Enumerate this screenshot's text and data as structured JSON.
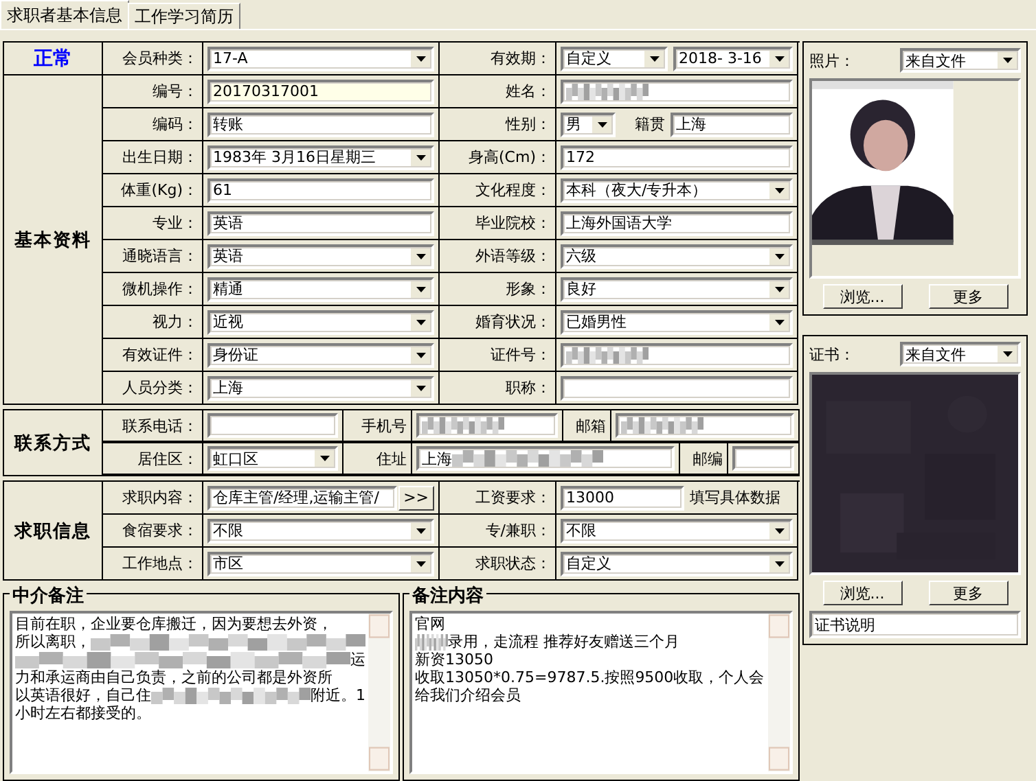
{
  "tabs": [
    {
      "label": "求职者基本信息",
      "selected": true
    },
    {
      "label": "工作学习简历",
      "selected": false
    }
  ],
  "header": {
    "status": "正常",
    "left": {
      "label": "会员种类：",
      "field": {
        "kind": "select",
        "value": "17-A"
      }
    },
    "right": {
      "label": "有效期：",
      "field": {
        "kind": "validity",
        "value": "自定义",
        "date": "2018- 3-16"
      }
    }
  },
  "basic": {
    "title": "基本资料",
    "rows": [
      {
        "left": {
          "label": "编号：",
          "field": {
            "kind": "highlighted",
            "value": "20170317001"
          }
        },
        "right": {
          "label": "姓名：",
          "field": {
            "kind": "redacted"
          }
        }
      },
      {
        "left": {
          "label": "编码：",
          "field": {
            "kind": "input",
            "value": "转账"
          }
        },
        "right": {
          "label": "性别：",
          "field": {
            "kind": "gender",
            "value": "男",
            "extra_label": "籍贯",
            "extra_value": "上海"
          }
        }
      },
      {
        "left": {
          "label": "出生日期：",
          "field": {
            "kind": "select",
            "value": "1983年 3月16日星期三"
          }
        },
        "right": {
          "label": "身高(Cm)：",
          "field": {
            "kind": "input",
            "value": "172"
          }
        }
      },
      {
        "left": {
          "label": "体重(Kg)：",
          "field": {
            "kind": "input",
            "value": "61"
          }
        },
        "right": {
          "label": "文化程度：",
          "field": {
            "kind": "select",
            "value": "本科（夜大/专升本）"
          }
        }
      },
      {
        "left": {
          "label": "专业：",
          "field": {
            "kind": "input",
            "value": "英语"
          }
        },
        "right": {
          "label": "毕业院校：",
          "field": {
            "kind": "input",
            "value": "上海外国语大学"
          }
        }
      },
      {
        "left": {
          "label": "通晓语言：",
          "field": {
            "kind": "select",
            "value": "英语"
          }
        },
        "right": {
          "label": "外语等级：",
          "field": {
            "kind": "select",
            "value": "六级"
          }
        }
      },
      {
        "left": {
          "label": "微机操作：",
          "field": {
            "kind": "select",
            "value": "精通"
          }
        },
        "right": {
          "label": "形象：",
          "field": {
            "kind": "select",
            "value": "良好"
          }
        }
      },
      {
        "left": {
          "label": "视力：",
          "field": {
            "kind": "select",
            "value": "近视"
          }
        },
        "right": {
          "label": "婚育状况：",
          "field": {
            "kind": "select",
            "value": "已婚男性"
          }
        }
      },
      {
        "left": {
          "label": "有效证件：",
          "field": {
            "kind": "select",
            "value": "身份证"
          }
        },
        "right": {
          "label": "证件号：",
          "field": {
            "kind": "redacted"
          }
        }
      },
      {
        "left": {
          "label": "人员分类：",
          "field": {
            "kind": "select",
            "value": "上海"
          }
        },
        "right": {
          "label": "职称：",
          "field": {
            "kind": "input"
          }
        }
      }
    ]
  },
  "contact": {
    "title": "联系方式",
    "rows": [
      [
        {
          "label": "联系电话：",
          "field": {
            "kind": "input"
          }
        },
        {
          "label": "手机号",
          "field": {
            "kind": "redacted"
          }
        },
        {
          "label": "邮箱",
          "field": {
            "kind": "redacted"
          }
        }
      ],
      [
        {
          "label": "居住区：",
          "field": {
            "kind": "select",
            "value": "虹口区"
          }
        },
        {
          "label": "住址",
          "field": {
            "kind": "partly-redacted",
            "value": "上海"
          }
        },
        {
          "label": "邮编",
          "field": {
            "kind": "input"
          }
        }
      ]
    ]
  },
  "job": {
    "title": "求职信息",
    "rows": [
      {
        "left": {
          "label": "求职内容：",
          "field": {
            "kind": "more",
            "value": "仓库主管/经理,运输主管/",
            "button": ">>"
          }
        },
        "right": {
          "label": "工资要求：",
          "field": {
            "kind": "note-input",
            "value": "13000",
            "note": "填写具体数据"
          }
        }
      },
      {
        "left": {
          "label": "食宿要求：",
          "field": {
            "kind": "select",
            "value": "不限"
          }
        },
        "right": {
          "label": "专/兼职：",
          "field": {
            "kind": "select",
            "value": "不限"
          }
        }
      },
      {
        "left": {
          "label": "工作地点：",
          "field": {
            "kind": "select",
            "value": "市区"
          }
        },
        "right": {
          "label": "求职状态：",
          "field": {
            "kind": "select",
            "value": "自定义"
          }
        }
      }
    ]
  },
  "notes": [
    {
      "title": "中介备注",
      "lines": [
        [
          {
            "kind": "text",
            "text": "目前在职，企业要仓库搬迁，因为要想去外资，"
          }
        ],
        [
          {
            "kind": "text",
            "text": "所以离职，"
          },
          {
            "kind": "redacted"
          }
        ],
        [
          {
            "kind": "redacted"
          },
          {
            "kind": "text",
            "text": "运"
          }
        ],
        [
          {
            "kind": "text",
            "text": "力和承运商由自己负责，之前的公司都是外资所"
          }
        ],
        [
          {
            "kind": "text",
            "text": "以英语很好，自己住"
          },
          {
            "kind": "redacted"
          },
          {
            "kind": "text",
            "text": "附近。1"
          }
        ],
        [
          {
            "kind": "text",
            "text": "小时左右都接受的。"
          }
        ]
      ]
    },
    {
      "title": "备注内容",
      "lines": [
        [
          {
            "kind": "text",
            "text": "官网"
          }
        ],
        [
          {
            "kind": "redacted"
          },
          {
            "kind": "text",
            "text": "录用，走流程 推荐好友赠送三个月"
          }
        ],
        [
          {
            "kind": "text",
            "text": "新资13050"
          }
        ],
        [
          {
            "kind": "text",
            "text": "收取13050*0.75=9787.5.按照9500收取，个人会"
          }
        ],
        [
          {
            "kind": "text",
            "text": "给我们介绍会员"
          }
        ]
      ]
    }
  ],
  "photo": {
    "label": "照片：",
    "source": "来自文件",
    "buttons": [
      "浏览...",
      "更多"
    ]
  },
  "certificate": {
    "label": "证书：",
    "source": "来自文件",
    "buttons": [
      "浏览...",
      "更多"
    ],
    "caption": "证书说明"
  }
}
